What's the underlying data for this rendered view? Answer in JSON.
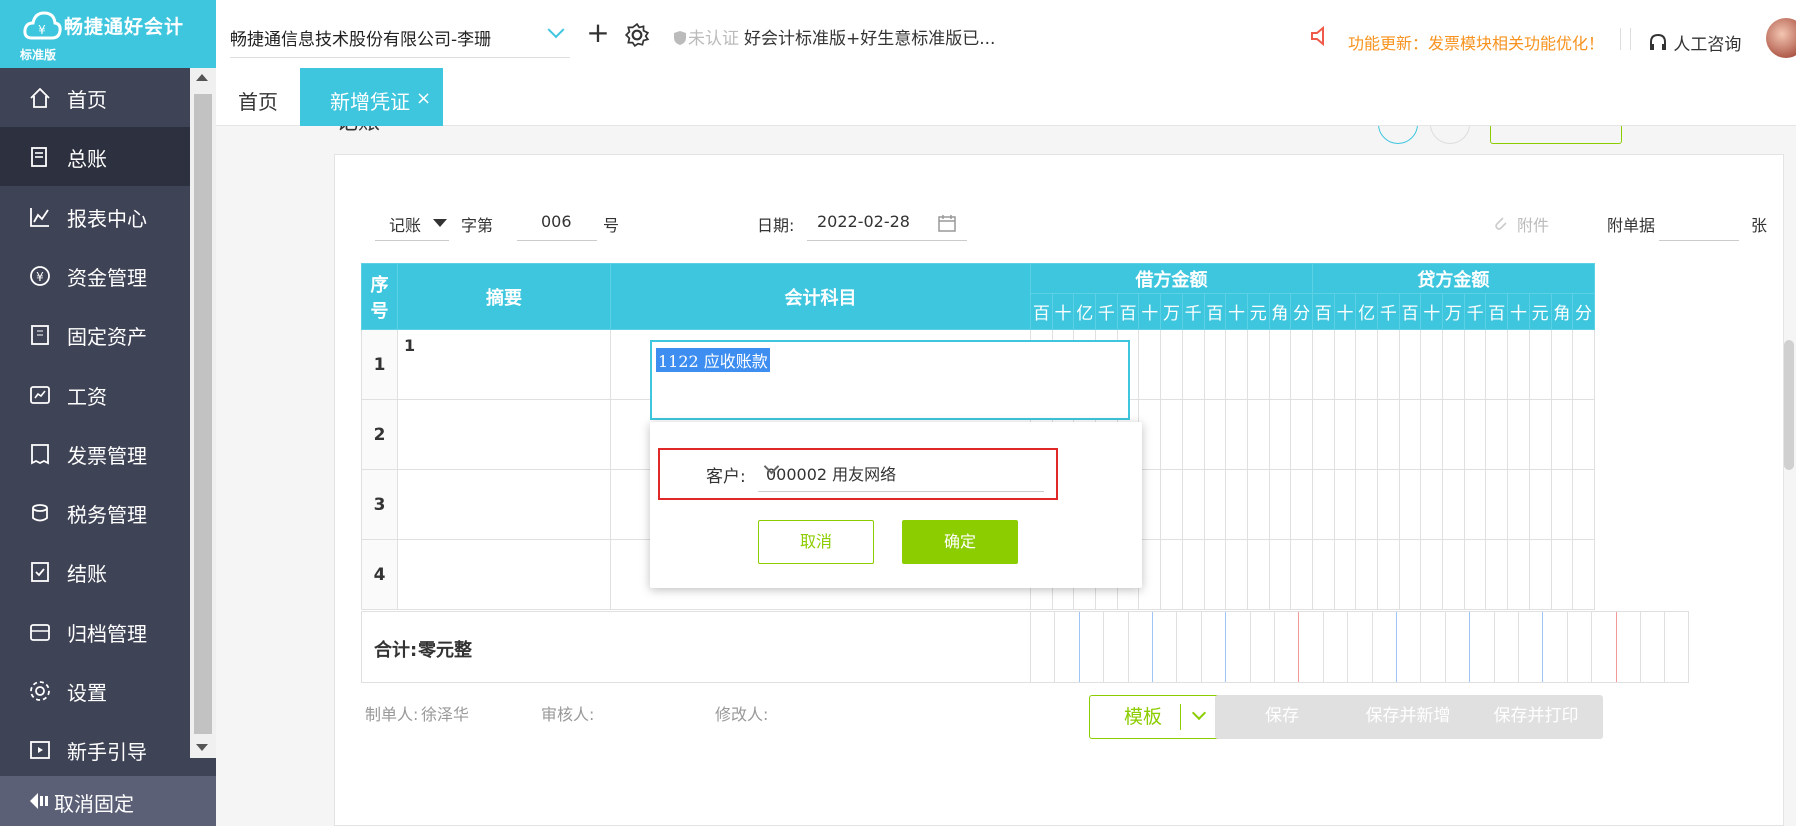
{
  "app": {
    "name": "畅捷通好会计",
    "edition_badge": "标准版"
  },
  "sidebar": {
    "items": [
      {
        "label": "首页",
        "icon": "home-icon"
      },
      {
        "label": "总账",
        "icon": "ledger-icon",
        "active": true
      },
      {
        "label": "报表中心",
        "icon": "chart-icon"
      },
      {
        "label": "资金管理",
        "icon": "money-icon"
      },
      {
        "label": "固定资产",
        "icon": "building-icon"
      },
      {
        "label": "工资",
        "icon": "salary-icon"
      },
      {
        "label": "发票管理",
        "icon": "invoice-icon"
      },
      {
        "label": "税务管理",
        "icon": "tax-icon"
      },
      {
        "label": "结账",
        "icon": "checkout-icon"
      },
      {
        "label": "归档管理",
        "icon": "archive-icon"
      },
      {
        "label": "设置",
        "icon": "gear-icon"
      },
      {
        "label": "新手引导",
        "icon": "guide-icon"
      }
    ],
    "unpin_label": "取消固定"
  },
  "topbar": {
    "company": "畅捷通信息技术股份有限公司-李珊",
    "cert_status": "未认证",
    "edition": "好会计标准版+好生意标准版已...",
    "notice": "功能更新：发票模块相关功能优化！",
    "support": "人工咨询"
  },
  "tabs": [
    {
      "label": "首页",
      "active": false
    },
    {
      "label": "新增凭证",
      "active": true,
      "closable": "×"
    }
  ],
  "voucher": {
    "cut_title": "记账",
    "type": "记账",
    "zi_label": "字第",
    "number": "006",
    "hao_label": "号",
    "date_label": "日期:",
    "date": "2022-02-28",
    "attach_link": "附件",
    "attach_label": "附单据",
    "attach_count": "",
    "zhang_label": "张",
    "columns": {
      "seq": "序号",
      "summary": "摘要",
      "account": "会计科目",
      "debit": "借方金额",
      "credit": "贷方金额"
    },
    "digits": [
      "百",
      "十",
      "亿",
      "千",
      "百",
      "十",
      "万",
      "千",
      "百",
      "十",
      "元",
      "角",
      "分"
    ],
    "rows": [
      {
        "seq": "1",
        "summary": "1",
        "account": "1122  应收账款"
      },
      {
        "seq": "2",
        "summary": "",
        "account": ""
      },
      {
        "seq": "3",
        "summary": "",
        "account": ""
      },
      {
        "seq": "4",
        "summary": "",
        "account": ""
      }
    ],
    "total_label": "合计:",
    "total_value": "零元整",
    "maker_label": "制单人:",
    "maker": "徐泽华",
    "reviewer_label": "审核人:",
    "modifier_label": "修改人:"
  },
  "popup": {
    "customer_label": "客户:",
    "customer_value": "000002  用友网络",
    "cancel": "取消",
    "ok": "确定"
  },
  "actions": {
    "template": "模板",
    "save": "保存",
    "save_new": "保存并新增",
    "save_print": "保存并打印"
  },
  "colors": {
    "accent": "#3ec6de",
    "green": "#8ccd00",
    "sidebar": "#3f4356",
    "warn": "#f7931e"
  }
}
